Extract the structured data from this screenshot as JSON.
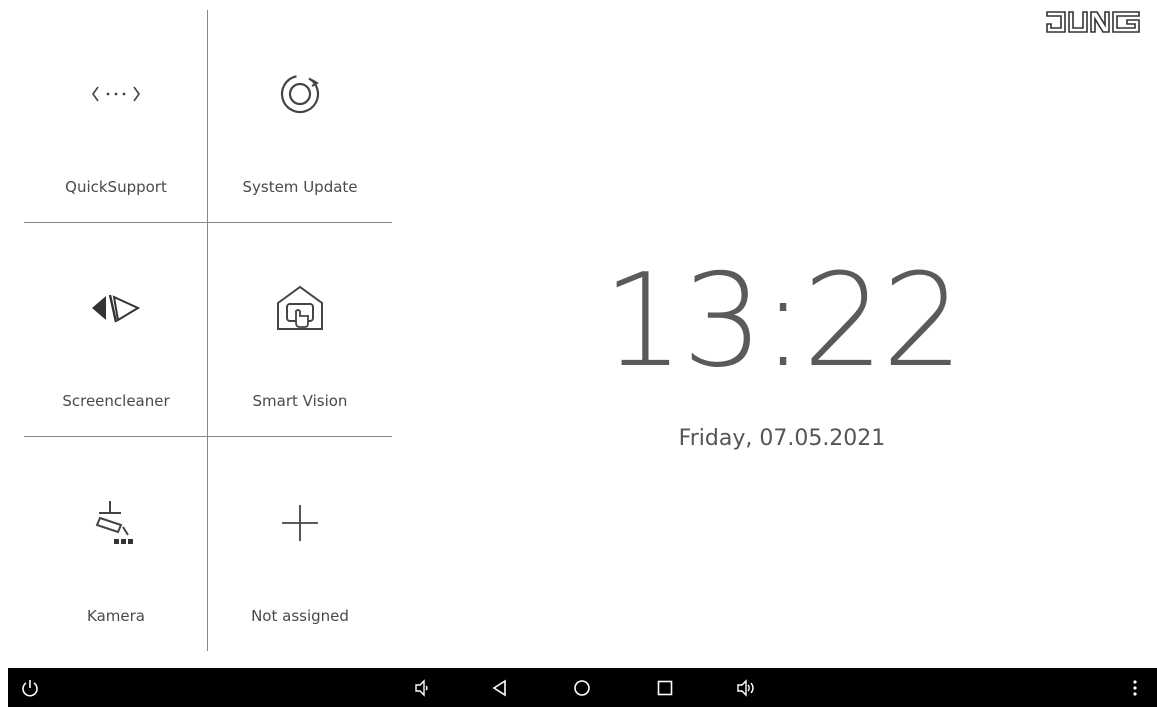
{
  "brand": {
    "logo_text": "JUNG"
  },
  "tiles": [
    {
      "label": "QuickSupport",
      "icon": "quicksupport-icon"
    },
    {
      "label": "System Update",
      "icon": "system-update-icon"
    },
    {
      "label": "Screencleaner",
      "icon": "screencleaner-icon"
    },
    {
      "label": "Smart Vision",
      "icon": "smart-vision-icon"
    },
    {
      "label": "Kamera",
      "icon": "camera-icon"
    },
    {
      "label": "Not assigned",
      "icon": "plus-icon"
    }
  ],
  "clock": {
    "time": "13:22",
    "date": "Friday, 07.05.2021"
  },
  "navbar": {
    "buttons": [
      "power-icon",
      "volume-down-icon",
      "back-icon",
      "home-icon",
      "recents-icon",
      "volume-up-icon",
      "more-icon"
    ]
  }
}
